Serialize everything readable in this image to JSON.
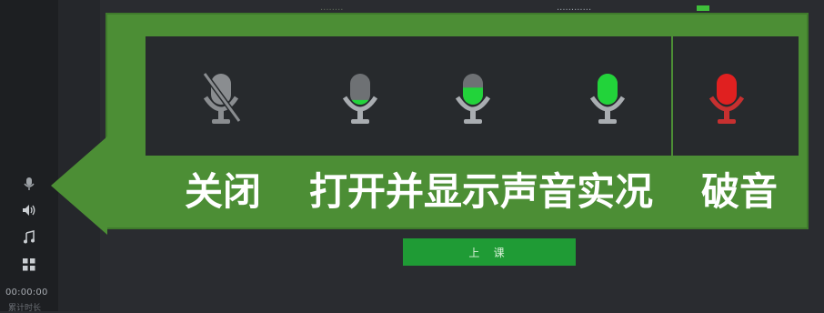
{
  "header": {
    "left_text": "........",
    "right_text": "............",
    "signal_color": "#3fbf3a"
  },
  "sidebar": {
    "icons": [
      "microphone-icon",
      "speaker-icon",
      "music-note-icon",
      "grid-icon"
    ],
    "timer": "00:00:00",
    "timer_sub": "累计时长"
  },
  "callout": {
    "color": "#4c8e35",
    "labels": {
      "off": "关闭",
      "live": "打开并显示声音实况",
      "clipping": "破音"
    },
    "mics": [
      {
        "state": "off",
        "icon": "mic-muted-icon",
        "color": "#8a8d90",
        "level": 0
      },
      {
        "state": "live",
        "icon": "mic-level-low-icon",
        "color": "#22d33a",
        "level": 0.15
      },
      {
        "state": "live",
        "icon": "mic-level-mid-icon",
        "color": "#22d33a",
        "level": 0.55
      },
      {
        "state": "live",
        "icon": "mic-level-high-icon",
        "color": "#22d33a",
        "level": 1.0
      },
      {
        "state": "clipping",
        "icon": "mic-clipping-icon",
        "color": "#e02020",
        "level": 1.0
      }
    ]
  },
  "footer": {
    "start_label": "上 课",
    "button_color": "#1f9b35"
  }
}
